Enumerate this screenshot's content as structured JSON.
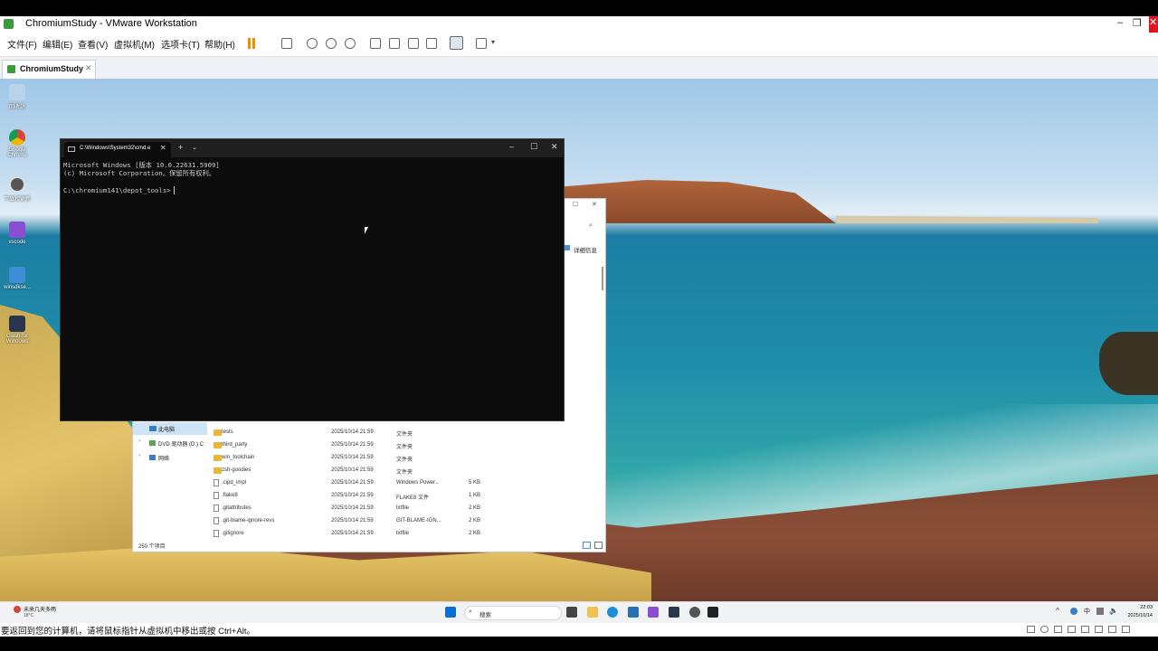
{
  "vmware": {
    "title": "ChromiumStudy - VMware Workstation",
    "menu": [
      "文件(F)",
      "编辑(E)",
      "查看(V)",
      "虚拟机(M)",
      "选项卡(T)",
      "帮助(H)"
    ],
    "tab_label": "ChromiumStudy",
    "status_message": "要返回到您的计算机，请将鼠标指针从虚拟机中移出或按 Ctrl+Alt。"
  },
  "desktop_icons": [
    {
      "label": "回收站",
      "icon": "recycle-bin-icon"
    },
    {
      "label": "Google Chrome",
      "icon": "chrome-icon"
    },
    {
      "label": "下载和更新",
      "icon": "app-icon"
    },
    {
      "label": "vscode",
      "icon": "visual-studio-icon"
    },
    {
      "label": "winsdkse...",
      "icon": "installer-icon"
    },
    {
      "label": "Clash for Windows",
      "icon": "cat-icon"
    }
  ],
  "cmd": {
    "tab_title": "C:\\Windows\\System32\\cmd.e",
    "lines": [
      "Microsoft Windows [版本 10.0.22631.5909]",
      "(c) Microsoft Corporation。保留所有权利。",
      "",
      "C:\\chromium141\\depot_tools>"
    ]
  },
  "explorer": {
    "details_label": "详细信息",
    "nav": [
      "此电脑",
      "DVD 驱动器 (D:) C",
      "网络"
    ],
    "files": [
      {
        "name": "tests",
        "date": "2025/10/14 21:59",
        "type": "文件夹",
        "size": "",
        "kind": "folder"
      },
      {
        "name": "third_party",
        "date": "2025/10/14 21:59",
        "type": "文件夹",
        "size": "",
        "kind": "folder"
      },
      {
        "name": "win_toolchain",
        "date": "2025/10/14 21:59",
        "type": "文件夹",
        "size": "",
        "kind": "folder"
      },
      {
        "name": "zsh-goodies",
        "date": "2025/10/14 21:59",
        "type": "文件夹",
        "size": "",
        "kind": "folder"
      },
      {
        "name": ".cipd_impl",
        "date": "2025/10/14 21:59",
        "type": "Windows Power...",
        "size": "5 KB",
        "kind": "file"
      },
      {
        "name": ".flake8",
        "date": "2025/10/14 21:59",
        "type": "FLAKE8 文件",
        "size": "1 KB",
        "kind": "file"
      },
      {
        "name": ".gitattributes",
        "date": "2025/10/14 21:59",
        "type": "txtfile",
        "size": "2 KB",
        "kind": "file"
      },
      {
        "name": ".git-blame-ignore-revs",
        "date": "2025/10/14 21:59",
        "type": "GIT-BLAME-IGN...",
        "size": "2 KB",
        "kind": "file"
      },
      {
        "name": ".gitignore",
        "date": "2025/10/14 21:59",
        "type": "txtfile",
        "size": "2 KB",
        "kind": "file"
      }
    ],
    "item_count": "250 个项目"
  },
  "taskbar": {
    "weather_text": "未来几天多雨",
    "weather_temp": "18°C",
    "search_placeholder": "搜索",
    "ime": "中",
    "time": "22:03",
    "date": "2025/10/14"
  }
}
